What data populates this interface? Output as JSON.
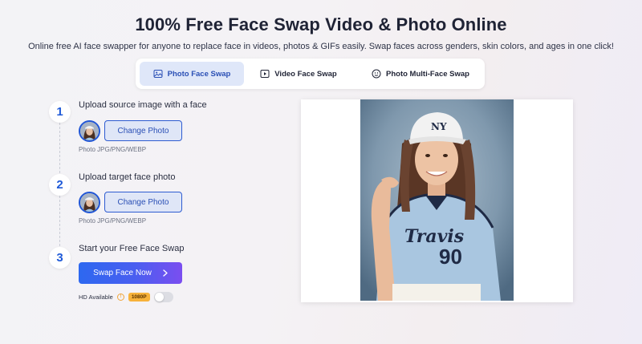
{
  "header": {
    "title": "100% Free Face Swap Video & Photo Online",
    "subtitle": "Online free AI face swapper for anyone to replace face in videos, photos & GIFs easily. Swap faces across genders, skin colors, and ages in one click!"
  },
  "tabs": [
    {
      "label": "Photo Face Swap",
      "icon": "image-icon",
      "active": true
    },
    {
      "label": "Video Face Swap",
      "icon": "video-icon",
      "active": false
    },
    {
      "label": "Photo Multi-Face Swap",
      "icon": "multi-face-icon",
      "active": false
    }
  ],
  "steps": [
    {
      "number": "1",
      "title": "Upload source image with a face",
      "button": "Change Photo",
      "hint": "Photo JPG/PNG/WEBP"
    },
    {
      "number": "2",
      "title": "Upload target face photo",
      "button": "Change Photo",
      "hint": "Photo JPG/PNG/WEBP"
    },
    {
      "number": "3",
      "title": "Start your Free Face Swap",
      "button": "Swap Face Now"
    }
  ],
  "hd": {
    "label": "HD Available",
    "badge": "1080P",
    "enabled": false
  },
  "preview": {
    "jersey_text": "Travis",
    "jersey_number": "90",
    "cap_logo": "NY"
  },
  "colors": {
    "accent": "#2156d6",
    "tab_active_bg": "#dfe7f9",
    "badge": "#f7b23b"
  }
}
